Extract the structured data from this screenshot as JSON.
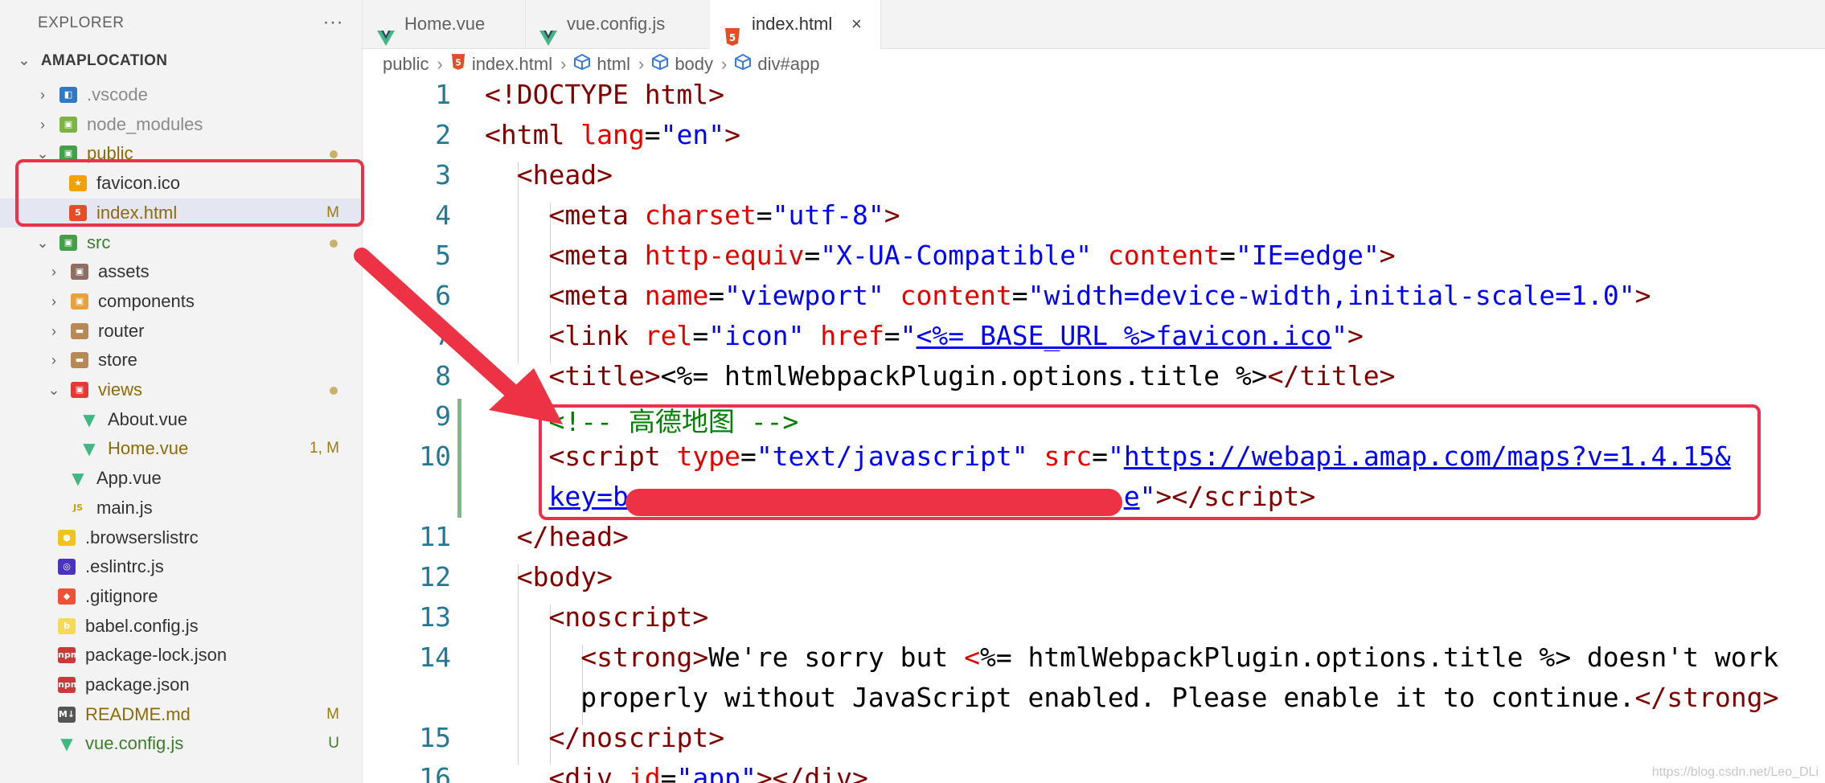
{
  "explorer": {
    "title": "EXPLORER",
    "more": "···",
    "project": "AMAPLOCATION",
    "tree": [
      {
        "name": ".vscode",
        "chev": "›",
        "icon": "vscode-folder-icon",
        "color": "#3178c6",
        "style": "dim"
      },
      {
        "name": "node_modules",
        "chev": "›",
        "icon": "node-modules-folder-icon",
        "color": "#7cb342",
        "style": "dim"
      },
      {
        "name": "public",
        "chev": "⌄",
        "icon": "public-folder-icon",
        "color": "#43a047",
        "style": "mod",
        "dot": true
      },
      {
        "name": "favicon.ico",
        "icon": "favicon-icon",
        "color": "#f2a100",
        "style": "normal"
      },
      {
        "name": "index.html",
        "icon": "html5-icon",
        "color": "#e44d26",
        "style": "mod",
        "badge": "M",
        "selected": true
      },
      {
        "name": "src",
        "chev": "⌄",
        "icon": "src-folder-icon",
        "color": "#43a047",
        "style": "untracked",
        "dot": true
      },
      {
        "name": "assets",
        "chev": "›",
        "icon": "assets-folder-icon",
        "color": "#8d6e63",
        "style": "normal"
      },
      {
        "name": "components",
        "chev": "›",
        "icon": "components-folder-icon",
        "color": "#e6a23c",
        "style": "normal"
      },
      {
        "name": "router",
        "chev": "›",
        "icon": "router-folder-icon",
        "color": "#b78a55",
        "style": "normal"
      },
      {
        "name": "store",
        "chev": "›",
        "icon": "store-folder-icon",
        "color": "#b78a55",
        "style": "normal"
      },
      {
        "name": "views",
        "chev": "⌄",
        "icon": "views-folder-icon",
        "color": "#e53935",
        "style": "mod",
        "dot": true
      },
      {
        "name": "About.vue",
        "icon": "vue-icon",
        "color": "#41b883",
        "style": "normal"
      },
      {
        "name": "Home.vue",
        "icon": "vue-icon",
        "color": "#41b883",
        "style": "mod",
        "badge": "1, M"
      },
      {
        "name": "App.vue",
        "icon": "vue-icon",
        "color": "#41b883",
        "style": "normal"
      },
      {
        "name": "main.js",
        "icon": "javascript-icon",
        "color": "#f0c419",
        "style": "normal"
      },
      {
        "name": ".browserslistrc",
        "icon": "browserslist-icon",
        "color": "#f0c419",
        "style": "normal"
      },
      {
        "name": ".eslintrc.js",
        "icon": "eslint-icon",
        "color": "#4b32c3",
        "style": "normal"
      },
      {
        "name": ".gitignore",
        "icon": "git-icon",
        "color": "#f05033",
        "style": "normal"
      },
      {
        "name": "babel.config.js",
        "icon": "babel-icon",
        "color": "#f5da55",
        "style": "normal"
      },
      {
        "name": "package-lock.json",
        "icon": "npm-icon",
        "color": "#cb3837",
        "style": "normal"
      },
      {
        "name": "package.json",
        "icon": "npm-icon",
        "color": "#cb3837",
        "style": "normal"
      },
      {
        "name": "README.md",
        "icon": "markdown-icon",
        "color": "#555555",
        "style": "mod",
        "badge": "M"
      },
      {
        "name": "vue.config.js",
        "icon": "vue-icon",
        "color": "#41b883",
        "style": "untracked",
        "badge": "U"
      }
    ]
  },
  "tabs": [
    {
      "label": "Home.vue",
      "icon": "vue-icon"
    },
    {
      "label": "vue.config.js",
      "icon": "vue-icon"
    },
    {
      "label": "index.html",
      "icon": "html5-icon",
      "active": true,
      "close": "×"
    }
  ],
  "breadcrumb": [
    "public",
    "index.html",
    "html",
    "body",
    "div#app"
  ],
  "editor": {
    "line_numbers": [
      "1",
      "2",
      "3",
      "4",
      "5",
      "6",
      "7",
      "8",
      "9",
      "10",
      "",
      "11",
      "12",
      "13",
      "14",
      "",
      "15",
      "16"
    ],
    "lines": [
      [
        [
          "br",
          "<!DOCTYPE "
        ],
        [
          "tag",
          "html"
        ],
        [
          "br",
          ">"
        ]
      ],
      [
        [
          "br",
          "<"
        ],
        [
          "tag",
          "html"
        ],
        [
          "txt",
          " "
        ],
        [
          "attr",
          "lang"
        ],
        [
          "txt",
          "="
        ],
        [
          "val",
          "\"en\""
        ],
        [
          "br",
          ">"
        ]
      ],
      [
        [
          "txt",
          "  "
        ],
        [
          "br",
          "<"
        ],
        [
          "tag",
          "head"
        ],
        [
          "br",
          ">"
        ]
      ],
      [
        [
          "txt",
          "    "
        ],
        [
          "br",
          "<"
        ],
        [
          "tag",
          "meta"
        ],
        [
          "txt",
          " "
        ],
        [
          "attr",
          "charset"
        ],
        [
          "txt",
          "="
        ],
        [
          "val",
          "\"utf-8\""
        ],
        [
          "br",
          ">"
        ]
      ],
      [
        [
          "txt",
          "    "
        ],
        [
          "br",
          "<"
        ],
        [
          "tag",
          "meta"
        ],
        [
          "txt",
          " "
        ],
        [
          "attr",
          "http-equiv"
        ],
        [
          "txt",
          "="
        ],
        [
          "val",
          "\"X-UA-Compatible\""
        ],
        [
          "txt",
          " "
        ],
        [
          "attr",
          "content"
        ],
        [
          "txt",
          "="
        ],
        [
          "val",
          "\"IE=edge\""
        ],
        [
          "br",
          ">"
        ]
      ],
      [
        [
          "txt",
          "    "
        ],
        [
          "br",
          "<"
        ],
        [
          "tag",
          "meta"
        ],
        [
          "txt",
          " "
        ],
        [
          "attr",
          "name"
        ],
        [
          "txt",
          "="
        ],
        [
          "val",
          "\"viewport\""
        ],
        [
          "txt",
          " "
        ],
        [
          "attr",
          "content"
        ],
        [
          "txt",
          "="
        ],
        [
          "val",
          "\"width=device-width,initial-scale=1.0\""
        ],
        [
          "br",
          ">"
        ]
      ],
      [
        [
          "txt",
          "    "
        ],
        [
          "br",
          "<"
        ],
        [
          "tag",
          "link"
        ],
        [
          "txt",
          " "
        ],
        [
          "attr",
          "rel"
        ],
        [
          "txt",
          "="
        ],
        [
          "val",
          "\"icon\""
        ],
        [
          "txt",
          " "
        ],
        [
          "attr",
          "href"
        ],
        [
          "txt",
          "="
        ],
        [
          "val",
          "\""
        ],
        [
          "link",
          "<%= BASE_URL %>favicon.ico"
        ],
        [
          "val",
          "\""
        ],
        [
          "br",
          ">"
        ]
      ],
      [
        [
          "txt",
          "    "
        ],
        [
          "br",
          "<"
        ],
        [
          "tag",
          "title"
        ],
        [
          "br",
          ">"
        ],
        [
          "txt",
          "<%= htmlWebpackPlugin.options.title %>"
        ],
        [
          "br",
          "</"
        ],
        [
          "tag",
          "title"
        ],
        [
          "br",
          ">"
        ]
      ],
      [
        [
          "txt",
          "    "
        ],
        [
          "com",
          "<!-- 高德地图 -->"
        ]
      ],
      [
        [
          "txt",
          "    "
        ],
        [
          "br",
          "<"
        ],
        [
          "tag",
          "script"
        ],
        [
          "txt",
          " "
        ],
        [
          "attr",
          "type"
        ],
        [
          "txt",
          "="
        ],
        [
          "val",
          "\"text/javascript\""
        ],
        [
          "txt",
          " "
        ],
        [
          "attr",
          "src"
        ],
        [
          "txt",
          "="
        ],
        [
          "val",
          "\""
        ],
        [
          "link",
          "https://webapi.amap.com/maps?v=1.4.15&"
        ]
      ],
      [
        [
          "txt",
          "    "
        ],
        [
          "link",
          "key=b"
        ],
        [
          "txt",
          "                               "
        ],
        [
          "link",
          "e"
        ],
        [
          "val",
          "\""
        ],
        [
          "br",
          "></"
        ],
        [
          "tag",
          "script"
        ],
        [
          "br",
          ">"
        ]
      ],
      [
        [
          "txt",
          "  "
        ],
        [
          "br",
          "</"
        ],
        [
          "tag",
          "head"
        ],
        [
          "br",
          ">"
        ]
      ],
      [
        [
          "txt",
          "  "
        ],
        [
          "br",
          "<"
        ],
        [
          "tag",
          "body"
        ],
        [
          "br",
          ">"
        ]
      ],
      [
        [
          "txt",
          "    "
        ],
        [
          "br",
          "<"
        ],
        [
          "tag",
          "noscript"
        ],
        [
          "br",
          ">"
        ]
      ],
      [
        [
          "txt",
          "      "
        ],
        [
          "br",
          "<"
        ],
        [
          "tag",
          "strong"
        ],
        [
          "br",
          ">"
        ],
        [
          "txt",
          "We're sorry but "
        ],
        [
          "attr",
          "<"
        ],
        [
          "txt",
          "%= htmlWebpackPlugin.options.title %> doesn't work"
        ]
      ],
      [
        [
          "txt",
          "      properly without JavaScript enabled. Please enable it to continue."
        ],
        [
          "br",
          "</"
        ],
        [
          "tag",
          "strong"
        ],
        [
          "br",
          ">"
        ]
      ],
      [
        [
          "txt",
          "    "
        ],
        [
          "br",
          "</"
        ],
        [
          "tag",
          "noscript"
        ],
        [
          "br",
          ">"
        ]
      ],
      [
        [
          "txt",
          "    "
        ],
        [
          "br",
          "<"
        ],
        [
          "tag",
          "div"
        ],
        [
          "txt",
          " "
        ],
        [
          "attr",
          "id"
        ],
        [
          "txt",
          "="
        ],
        [
          "val",
          "\"app\""
        ],
        [
          "br",
          "></"
        ],
        [
          "tag",
          "div"
        ],
        [
          "br",
          ">"
        ]
      ]
    ]
  },
  "watermark": "https://blog.csdn.net/Leo_DLi",
  "colors": {
    "highlight": "#e8334a",
    "redaction": "#ee3245",
    "git_modified": "#81b88b"
  }
}
